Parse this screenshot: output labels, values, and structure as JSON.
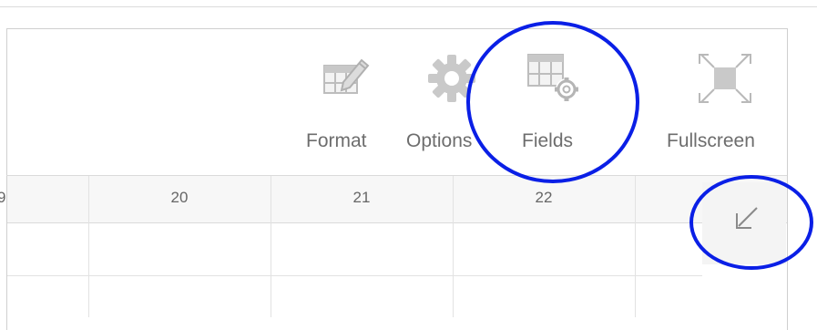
{
  "toolbar": {
    "format_label": "Format",
    "options_label": "Options",
    "fields_label": "Fields",
    "fullscreen_label": "Fullscreen"
  },
  "grid": {
    "partial_column_label": "9",
    "column_headers": [
      "20",
      "21",
      "22"
    ]
  },
  "icons": {
    "format": "format-table-pencil-icon",
    "options": "gear-icon",
    "fields": "table-gear-icon",
    "fullscreen": "expand-arrows-icon",
    "collapse": "arrow-down-left-icon"
  },
  "colors": {
    "annotation_circle": "#0a1fe6",
    "icon_gray": "#bdbdbd",
    "label_gray": "#6d6d6d"
  }
}
